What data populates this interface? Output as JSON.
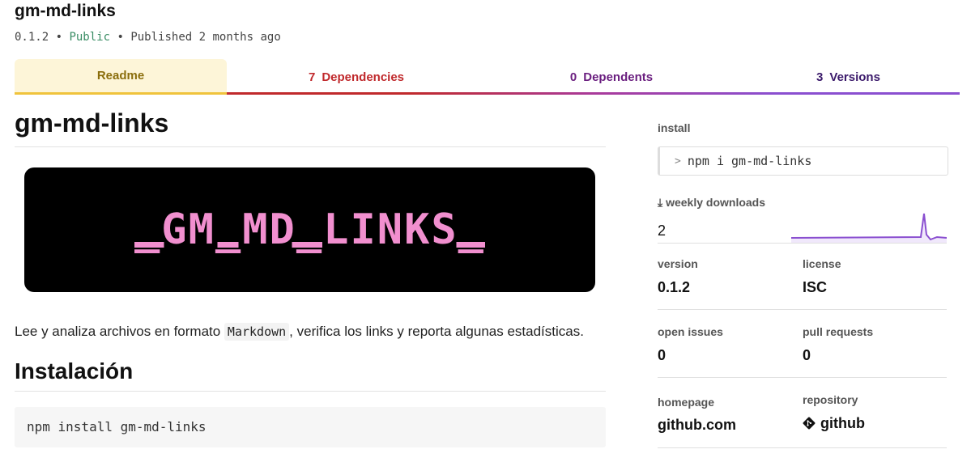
{
  "header": {
    "title": "gm-md-links",
    "version": "0.1.2",
    "sep1": " • ",
    "visibility": "Public",
    "sep2": " • Published ",
    "published": "2 months ago"
  },
  "tabs": [
    {
      "count": "",
      "label": "Readme"
    },
    {
      "count": "7",
      "label": "Dependencies"
    },
    {
      "count": "0",
      "label": "Dependents"
    },
    {
      "count": "3",
      "label": "Versions"
    }
  ],
  "readme": {
    "heading": "gm-md-links",
    "banner_text": "_GM_MD_LINKS_",
    "desc_before": "Lee y analiza archivos en formato ",
    "desc_code": "Markdown",
    "desc_after": ", verifica los links y reporta algunas estadísticas.",
    "install_heading": "Instalación",
    "install_code": "npm install gm-md-links"
  },
  "sidebar": {
    "install_label": "install",
    "install_cmd": "npm i gm-md-links",
    "weekly_label": "weekly downloads",
    "weekly_value": "2",
    "version_label": "version",
    "version_value": "0.1.2",
    "license_label": "license",
    "license_value": "ISC",
    "issues_label": "open issues",
    "issues_value": "0",
    "prs_label": "pull requests",
    "prs_value": "0",
    "homepage_label": "homepage",
    "homepage_value": "github.com",
    "repo_label": "repository",
    "repo_value": "github"
  },
  "colors": {
    "readme_tab": "#8a6d0b",
    "dependencies_tab": "#c0292c",
    "dependents_tab": "#6a1e7f",
    "versions_tab": "#3b1a6b",
    "sparkline": "#8a4fd0"
  },
  "icons": {
    "install_prompt": "chevron-right-icon",
    "weekly": "download-icon",
    "repository": "git-icon"
  }
}
